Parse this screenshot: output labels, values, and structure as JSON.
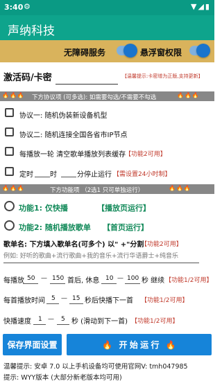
{
  "status": {
    "time": "3:40",
    "settings_glyph": "⚙",
    "icons": "▼◢▮"
  },
  "app": {
    "title": "声纳科技"
  },
  "permissions": {
    "accessibility_label": "无障碍服务",
    "overlay_label": "悬浮窗权限"
  },
  "activation": {
    "label": "激活码/卡密",
    "value": "",
    "placeholder": "",
    "hint": "【温馨提示:卡密增为正版,支持更新】"
  },
  "protocol_band": {
    "fire": "🔥🔥🔥",
    "text": "下方协议项 (可多选): 如需要勾选/不需要不勾选"
  },
  "protocols": [
    {
      "label": "协议一: 随机伪装新设备机型"
    },
    {
      "label": "协议二: 随机连接全国各省市IP节点"
    },
    {
      "label": "每播放一轮 清空歌单播放列表缓存",
      "tag": "【功能2可用】"
    }
  ],
  "timer": {
    "prefix": "定时",
    "hour": "时",
    "suffix": "分停止运行",
    "tag": "【需设置24小时制】"
  },
  "function_band": {
    "fire": "🔥🔥🔥",
    "text": "下方功能项 （2选1 只可单独运行）"
  },
  "functions": [
    {
      "label": "功能1: 仅快播",
      "tag": "【播放页运行】"
    },
    {
      "label": "功能2: 随机播放歌单",
      "tag": "【首页运行】"
    }
  ],
  "playlist": {
    "label": "歌单名: 下方填入歌单名(可多个)  以\" +\"分割",
    "tag": "【功能2可用】",
    "placeholder": "例如: 好听的歌曲+流行歌曲+我的音乐+流行华语爵士+纯音乐"
  },
  "play_range": {
    "prefix": "每播放",
    "from": "50",
    "dash": "—",
    "to": "150",
    "middle": "首后, 休息",
    "rest_from": "10",
    "rest_to": "100",
    "suffix": "秒 继续",
    "tag": "【功能1/2可用】"
  },
  "play_time": {
    "prefix": "每首播放时间",
    "from": "5",
    "dash": "—",
    "to": "15",
    "suffix": "秒后快播下一首",
    "tag": "【功能1/2可用】"
  },
  "speed": {
    "prefix": "快播速度",
    "from": "1",
    "dash": "—",
    "to": "5",
    "suffix": "秒 (滑动到下一首)",
    "tag": "【功能1/2可用】"
  },
  "buttons": {
    "save": "保存界面设置",
    "start": "开 始 运 行",
    "fire": "🔥"
  },
  "footer": {
    "line1": "温馨提示: 安卓 7.0 以上手机设备均可使用官网V: tmh047985",
    "line2": "提示: WYY版本 (大部分新老版本均可用)"
  },
  "colors": {
    "statusbar": "#0a9a84",
    "appbar": "#0ea48c",
    "permission_bar": "#d9b35c",
    "band": "#878787",
    "accent_blue": "#1684d9",
    "hint_red": "#c0392b",
    "green": "#138a5a"
  }
}
